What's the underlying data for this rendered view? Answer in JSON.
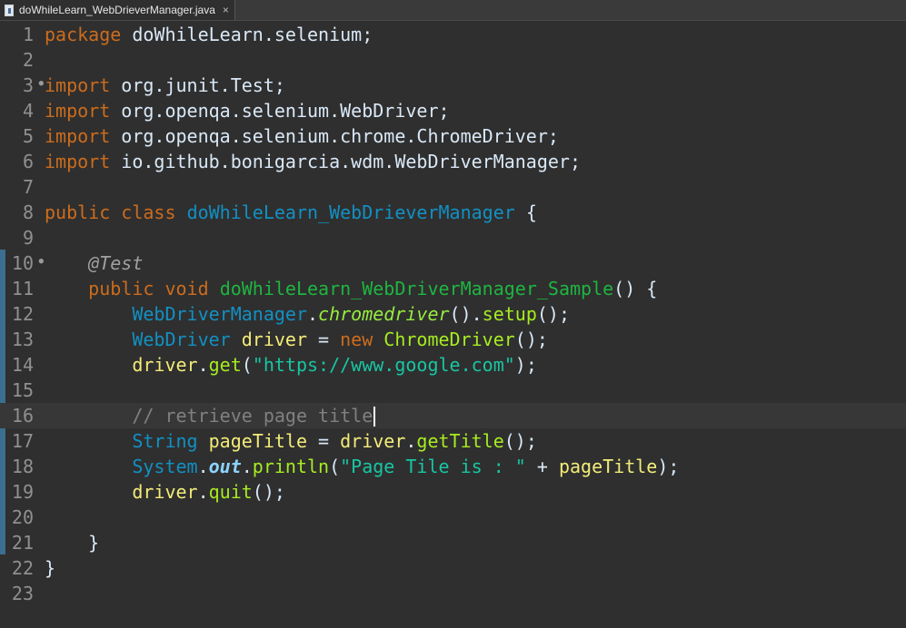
{
  "tab": {
    "title": "doWhileLearn_WebDrieverManager.java",
    "close_glyph": "×",
    "icon": "java-file-icon"
  },
  "lines": [
    {
      "n": "1",
      "fold": false,
      "current": false,
      "tokens": [
        [
          "kw",
          "package"
        ],
        [
          "def",
          " doWhileLearn.selenium;"
        ]
      ]
    },
    {
      "n": "2",
      "fold": false,
      "current": false,
      "tokens": []
    },
    {
      "n": "3",
      "fold": true,
      "current": false,
      "tokens": [
        [
          "kw",
          "import"
        ],
        [
          "def",
          " org.junit.Test;"
        ]
      ]
    },
    {
      "n": "4",
      "fold": false,
      "current": false,
      "tokens": [
        [
          "kw",
          "import"
        ],
        [
          "def",
          " org.openqa.selenium.WebDriver;"
        ]
      ]
    },
    {
      "n": "5",
      "fold": false,
      "current": false,
      "tokens": [
        [
          "kw",
          "import"
        ],
        [
          "def",
          " org.openqa.selenium.chrome.ChromeDriver;"
        ]
      ]
    },
    {
      "n": "6",
      "fold": false,
      "current": false,
      "tokens": [
        [
          "kw",
          "import"
        ],
        [
          "def",
          " io.github.bonigarcia.wdm.WebDriverManager;"
        ]
      ]
    },
    {
      "n": "7",
      "fold": false,
      "current": false,
      "tokens": []
    },
    {
      "n": "8",
      "fold": false,
      "current": false,
      "tokens": [
        [
          "kw",
          "public"
        ],
        [
          "def",
          " "
        ],
        [
          "kw",
          "class"
        ],
        [
          "def",
          " "
        ],
        [
          "cls",
          "doWhileLearn_WebDrieverManager"
        ],
        [
          "def",
          " {"
        ]
      ]
    },
    {
      "n": "9",
      "fold": false,
      "current": false,
      "tokens": []
    },
    {
      "n": "10",
      "fold": true,
      "current": false,
      "tokens": [
        [
          "def",
          "    "
        ],
        [
          "ann",
          "@Test"
        ]
      ]
    },
    {
      "n": "11",
      "fold": false,
      "current": false,
      "tokens": [
        [
          "def",
          "    "
        ],
        [
          "kw",
          "public"
        ],
        [
          "def",
          " "
        ],
        [
          "kw",
          "void"
        ],
        [
          "def",
          " "
        ],
        [
          "meth",
          "doWhileLearn_WebDriverManager_Sample"
        ],
        [
          "def",
          "() {"
        ]
      ]
    },
    {
      "n": "12",
      "fold": false,
      "current": false,
      "tokens": [
        [
          "def",
          "        "
        ],
        [
          "cls",
          "WebDriverManager"
        ],
        [
          "def",
          "."
        ],
        [
          "ital",
          "chromedriver"
        ],
        [
          "def",
          "()."
        ],
        [
          "call",
          "setup"
        ],
        [
          "def",
          "();"
        ]
      ]
    },
    {
      "n": "13",
      "fold": false,
      "current": false,
      "tokens": [
        [
          "def",
          "        "
        ],
        [
          "cls",
          "WebDriver"
        ],
        [
          "def",
          " "
        ],
        [
          "var",
          "driver"
        ],
        [
          "def",
          " = "
        ],
        [
          "kw",
          "new"
        ],
        [
          "def",
          " "
        ],
        [
          "call",
          "ChromeDriver"
        ],
        [
          "def",
          "();"
        ]
      ]
    },
    {
      "n": "14",
      "fold": false,
      "current": false,
      "tokens": [
        [
          "def",
          "        "
        ],
        [
          "var",
          "driver"
        ],
        [
          "def",
          "."
        ],
        [
          "call",
          "get"
        ],
        [
          "def",
          "("
        ],
        [
          "str",
          "\"https://www.google.com\""
        ],
        [
          "def",
          ");"
        ]
      ]
    },
    {
      "n": "15",
      "fold": false,
      "current": false,
      "tokens": []
    },
    {
      "n": "16",
      "fold": false,
      "current": true,
      "tokens": [
        [
          "def",
          "        "
        ],
        [
          "cmt",
          "// retrieve page title"
        ]
      ]
    },
    {
      "n": "17",
      "fold": false,
      "current": false,
      "tokens": [
        [
          "def",
          "        "
        ],
        [
          "cls",
          "String"
        ],
        [
          "def",
          " "
        ],
        [
          "var",
          "pageTitle"
        ],
        [
          "def",
          " = "
        ],
        [
          "var",
          "driver"
        ],
        [
          "def",
          "."
        ],
        [
          "call",
          "getTitle"
        ],
        [
          "def",
          "();"
        ]
      ]
    },
    {
      "n": "18",
      "fold": false,
      "current": false,
      "tokens": [
        [
          "def",
          "        "
        ],
        [
          "cls",
          "System"
        ],
        [
          "def",
          "."
        ],
        [
          "fld",
          "out"
        ],
        [
          "def",
          "."
        ],
        [
          "call",
          "println"
        ],
        [
          "def",
          "("
        ],
        [
          "str",
          "\"Page Tile is : \""
        ],
        [
          "def",
          " + "
        ],
        [
          "var",
          "pageTitle"
        ],
        [
          "def",
          ");"
        ]
      ]
    },
    {
      "n": "19",
      "fold": false,
      "current": false,
      "tokens": [
        [
          "def",
          "        "
        ],
        [
          "var",
          "driver"
        ],
        [
          "def",
          "."
        ],
        [
          "call",
          "quit"
        ],
        [
          "def",
          "();"
        ]
      ]
    },
    {
      "n": "20",
      "fold": false,
      "current": false,
      "tokens": []
    },
    {
      "n": "21",
      "fold": false,
      "current": false,
      "tokens": [
        [
          "def",
          "    }"
        ]
      ]
    },
    {
      "n": "22",
      "fold": false,
      "current": false,
      "tokens": [
        [
          "def",
          "}"
        ]
      ]
    },
    {
      "n": "23",
      "fold": false,
      "current": false,
      "tokens": []
    }
  ],
  "colors": {
    "keyword": "#cc6c1d",
    "class": "#1290c3",
    "method_decl": "#1eb540",
    "variable": "#f3ec79",
    "string": "#17c6a3",
    "comment": "#808080",
    "background": "#2f2f2f"
  }
}
